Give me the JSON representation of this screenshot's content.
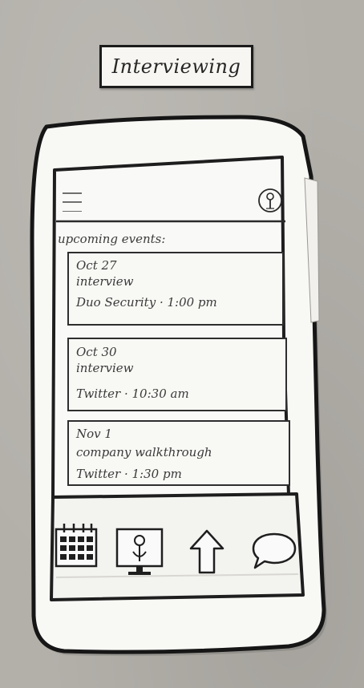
{
  "title_card": {
    "text": "Interviewing"
  },
  "header": {
    "menu_icon": "hamburger-menu-icon",
    "profile_icon": "profile-icon"
  },
  "section": {
    "title": "upcoming events:"
  },
  "events": [
    {
      "date": "Oct 27",
      "type": "interview",
      "detail": "Duo Security · 1:00 pm"
    },
    {
      "date": "Oct 30",
      "type": "interview",
      "detail": "Twitter · 10:30 am"
    },
    {
      "date": "Nov 1",
      "type": "company walkthrough",
      "detail": "Twitter · 1:30 pm"
    }
  ],
  "bottom_nav": {
    "items": [
      {
        "icon": "calendar-icon"
      },
      {
        "icon": "presentation-icon"
      },
      {
        "icon": "upload-arrow-icon"
      },
      {
        "icon": "chat-bubble-icon"
      }
    ]
  },
  "colors": {
    "ink": "#1c1c1c",
    "paper": "#f7f6f2",
    "background": "#b3b0aa"
  }
}
